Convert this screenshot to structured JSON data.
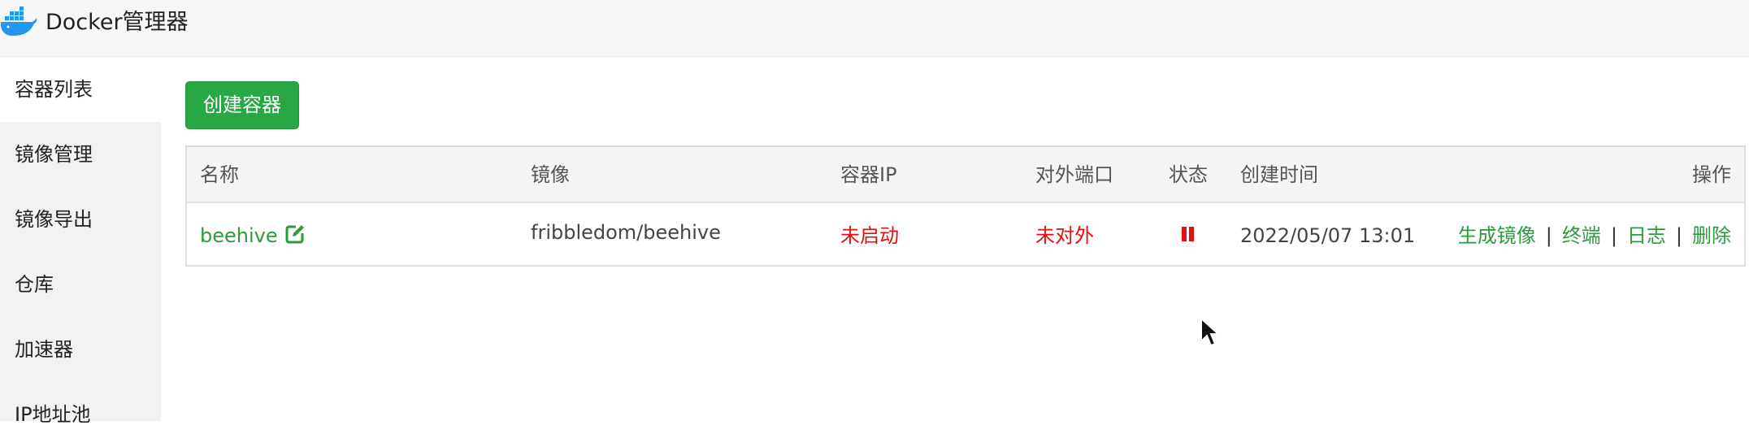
{
  "app": {
    "title": "Docker管理器",
    "logo_icon": "docker-whale-icon"
  },
  "sidebar": {
    "items": [
      {
        "label": "容器列表",
        "active": true
      },
      {
        "label": "镜像管理",
        "active": false
      },
      {
        "label": "镜像导出",
        "active": false
      },
      {
        "label": "仓库",
        "active": false
      },
      {
        "label": "加速器",
        "active": false
      },
      {
        "label": "IP地址池",
        "active": false
      }
    ]
  },
  "toolbar": {
    "create_label": "创建容器"
  },
  "table": {
    "headers": {
      "name": "名称",
      "image": "镜像",
      "ip": "容器IP",
      "ports": "对外端口",
      "status": "状态",
      "created": "创建时间",
      "actions": "操作"
    },
    "rows": [
      {
        "name": "beehive",
        "image": "fribbledom/beehive",
        "ip": "未启动",
        "ports": "未对外",
        "status_icon": "pause-icon",
        "created": "2022/05/07 13:01",
        "actions": {
          "build_image": "生成镜像",
          "terminal": "终端",
          "logs": "日志",
          "delete": "删除",
          "separator": "|"
        }
      }
    ]
  },
  "colors": {
    "accent_green": "#28a745",
    "link_green": "#2a9c3e",
    "status_red": "#e60f0f",
    "docker_blue": "#2496ed"
  }
}
